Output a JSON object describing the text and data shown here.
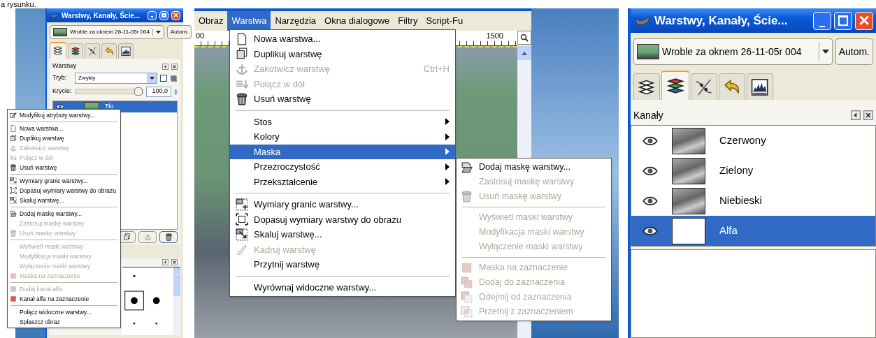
{
  "caption": "a rysunku.",
  "layers_dock": {
    "title": "Warstwy, Kanały, Ście...",
    "image_name": "Wroble za oknem 26-11-05r 004",
    "auto_button": "Autom.",
    "tabs": [
      {
        "selected": true
      },
      {
        "selected": false
      },
      {
        "selected": false
      },
      {
        "selected": false
      },
      {
        "selected": false
      }
    ],
    "panel_title": "Warstwy",
    "mode_label": "Tryb:",
    "mode_value": "Zwykły",
    "lock_checked": false,
    "opacity_label": "Krycie:",
    "opacity": {
      "level": 1
    },
    "opacity_value": "100,0",
    "layers": [
      {
        "name": "Tło",
        "selected": true
      }
    ],
    "context_menu": [
      {
        "kind": "item",
        "label": "Modyfikuj atrybuty warstwy...",
        "disabled": false
      },
      {
        "kind": "separator"
      },
      {
        "kind": "item",
        "label": "Nowa warstwa...",
        "disabled": false
      },
      {
        "kind": "item",
        "label": "Duplikuj warstwę",
        "disabled": false
      },
      {
        "kind": "item",
        "label": "Zakotwicz warstwę",
        "disabled": true
      },
      {
        "kind": "item",
        "label": "Połącz w dół",
        "disabled": true
      },
      {
        "kind": "item",
        "label": "Usuń warstwę",
        "disabled": false
      },
      {
        "kind": "separator"
      },
      {
        "kind": "item",
        "label": "Wymiary granic warstwy...",
        "disabled": false
      },
      {
        "kind": "item",
        "label": "Dopasuj wymiary warstwy do obrazu",
        "disabled": false
      },
      {
        "kind": "item",
        "label": "Skaluj warstwę...",
        "disabled": false
      },
      {
        "kind": "separator"
      },
      {
        "kind": "item",
        "label": "Dodaj maskę warstwy...",
        "disabled": false
      },
      {
        "kind": "item",
        "label": "Zastosuj maskę warstwy",
        "disabled": true
      },
      {
        "kind": "item",
        "label": "Usuń maskę warstwy",
        "disabled": true
      },
      {
        "kind": "separator"
      },
      {
        "kind": "item",
        "label": "Wyświetl maski warstwy",
        "disabled": true
      },
      {
        "kind": "item",
        "label": "Modyfikacja maski warstwy",
        "disabled": true
      },
      {
        "kind": "item",
        "label": "Wyłączenie maski warstwy",
        "disabled": true
      },
      {
        "kind": "item",
        "label": "Maska na zaznaczenie",
        "disabled": true
      },
      {
        "kind": "separator"
      },
      {
        "kind": "item",
        "label": "Dodaj kanał alfa",
        "disabled": true
      },
      {
        "kind": "item",
        "label": "Kanał alfa na zaznaczenie",
        "disabled": false
      },
      {
        "kind": "separator"
      },
      {
        "kind": "item",
        "label": "Połącz widoczne warstwy...",
        "disabled": false
      },
      {
        "kind": "item",
        "label": "Spłaszcz obraz",
        "disabled": false
      }
    ]
  },
  "image_window": {
    "menubar": [
      {
        "label": "Obraz",
        "selected": false
      },
      {
        "label": "Warstwa",
        "selected": true
      },
      {
        "label": "Narzędzia",
        "selected": false
      },
      {
        "label": "Okna dialogowe",
        "selected": false
      },
      {
        "label": "Filtry",
        "selected": false
      },
      {
        "label": "Script-Fu",
        "selected": false
      }
    ],
    "ruler_labels": [
      "00",
      "1500"
    ],
    "menu": [
      {
        "kind": "item",
        "label": "Nowa warstwa...",
        "disabled": false,
        "selected": false
      },
      {
        "kind": "item",
        "label": "Duplikuj warstwę",
        "disabled": false,
        "selected": false
      },
      {
        "kind": "item",
        "label": "Zakotwicz warstwę",
        "shortcut": "Ctrl+H",
        "disabled": true,
        "selected": false
      },
      {
        "kind": "item",
        "label": "Połącz w dół",
        "disabled": true,
        "selected": false
      },
      {
        "kind": "item",
        "label": "Usuń warstwę",
        "disabled": false,
        "selected": false
      },
      {
        "kind": "separator"
      },
      {
        "kind": "submenu",
        "label": "Stos",
        "disabled": false,
        "selected": false
      },
      {
        "kind": "submenu",
        "label": "Kolory",
        "disabled": false,
        "selected": false
      },
      {
        "kind": "submenu",
        "label": "Maska",
        "disabled": false,
        "selected": true
      },
      {
        "kind": "submenu",
        "label": "Przezroczystość",
        "disabled": false,
        "selected": false
      },
      {
        "kind": "submenu",
        "label": "Przekształcenie",
        "disabled": false,
        "selected": false
      },
      {
        "kind": "separator"
      },
      {
        "kind": "item",
        "label": "Wymiary granic warstwy...",
        "disabled": false,
        "selected": false
      },
      {
        "kind": "item",
        "label": "Dopasuj wymiary warstwy do obrazu",
        "disabled": false,
        "selected": false
      },
      {
        "kind": "item",
        "label": "Skaluj warstwę...",
        "disabled": false,
        "selected": false
      },
      {
        "kind": "item",
        "label": "Kadruj warstwę",
        "disabled": true,
        "selected": false
      },
      {
        "kind": "item",
        "label": "Przytnij warstwę",
        "disabled": false,
        "selected": false
      },
      {
        "kind": "separator"
      },
      {
        "kind": "item",
        "label": "Wyrównaj widoczne warstwy...",
        "disabled": false,
        "selected": false
      }
    ],
    "submenu": [
      {
        "kind": "item",
        "label": "Dodaj maskę warstwy...",
        "disabled": false
      },
      {
        "kind": "item",
        "label": "Zastosuj maskę warstwy",
        "disabled": true
      },
      {
        "kind": "item",
        "label": "Usuń maskę warstwy",
        "disabled": true
      },
      {
        "kind": "separator"
      },
      {
        "kind": "item",
        "label": "Wyświetl maski warstwy",
        "disabled": true
      },
      {
        "kind": "item",
        "label": "Modyfikacja maski warstwy",
        "disabled": true
      },
      {
        "kind": "item",
        "label": "Wyłączenie maski warstwy",
        "disabled": true
      },
      {
        "kind": "separator"
      },
      {
        "kind": "item",
        "label": "Maska na zaznaczenie",
        "disabled": true
      },
      {
        "kind": "item",
        "label": "Dodaj do zaznaczenia",
        "disabled": true
      },
      {
        "kind": "item",
        "label": "Odejmij od zaznaczenia",
        "disabled": true
      },
      {
        "kind": "item",
        "label": "Przetnij z zaznaczeniem",
        "disabled": true
      }
    ]
  },
  "channels_dock": {
    "title": "Warstwy, Kanały, Ście...",
    "image_name": "Wroble za oknem 26-11-05r 004",
    "auto_button": "Autom.",
    "tabs": [
      {
        "selected": false
      },
      {
        "selected": true
      },
      {
        "selected": false
      },
      {
        "selected": false
      },
      {
        "selected": false
      }
    ],
    "panel_title": "Kanały",
    "channels": [
      {
        "name": "Czerwony",
        "selected": false
      },
      {
        "name": "Zielony",
        "selected": false
      },
      {
        "name": "Niebieski",
        "selected": false
      },
      {
        "name": "Alfa",
        "selected": true
      }
    ]
  }
}
